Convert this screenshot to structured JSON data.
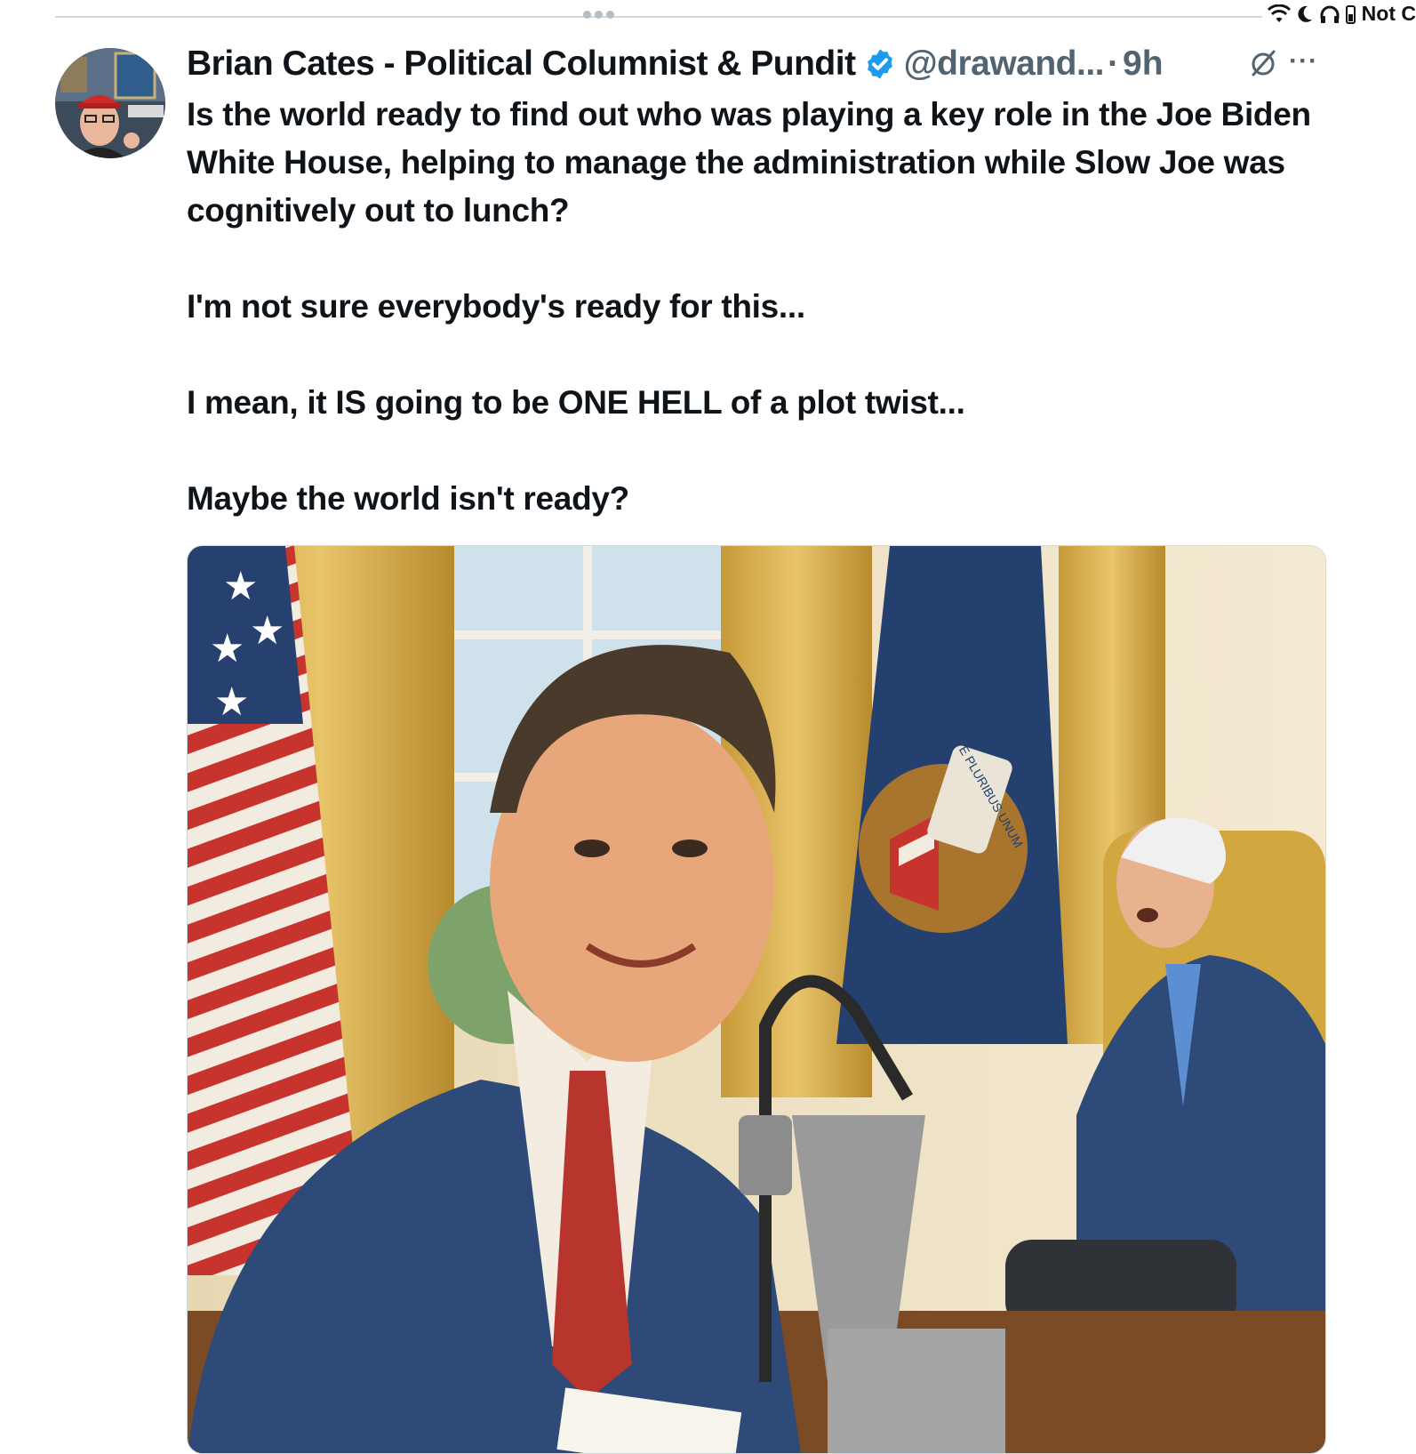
{
  "status_bar": {
    "carrier_text": "Not C",
    "icons": [
      "wifi-icon",
      "moon-icon",
      "headphones-icon",
      "battery-icon"
    ]
  },
  "tweet": {
    "author": {
      "display_name": "Brian Cates - Political Columnist & Pundit",
      "handle": "@drawand...",
      "verified": true,
      "verified_color": "#1d9bf0"
    },
    "separator": "·",
    "timestamp": "9h",
    "actions": [
      "grok-icon",
      "more-icon"
    ],
    "more_label": "···",
    "paragraphs": [
      "Is the world ready to find out who was playing a key role in the Joe Biden White House, helping to manage the administration while Slow Joe was cognitively out to lunch?",
      "I'm not sure everybody's ready for this...",
      "I mean, it IS going to be ONE HELL  of a plot twist...",
      "Maybe the world isn't ready?"
    ],
    "media": {
      "type": "illustration",
      "seal_text": "E PLURIBUS UNUM"
    }
  },
  "colors": {
    "text_primary": "#0f1419",
    "text_secondary": "#536471",
    "divider": "#cfd9de"
  }
}
